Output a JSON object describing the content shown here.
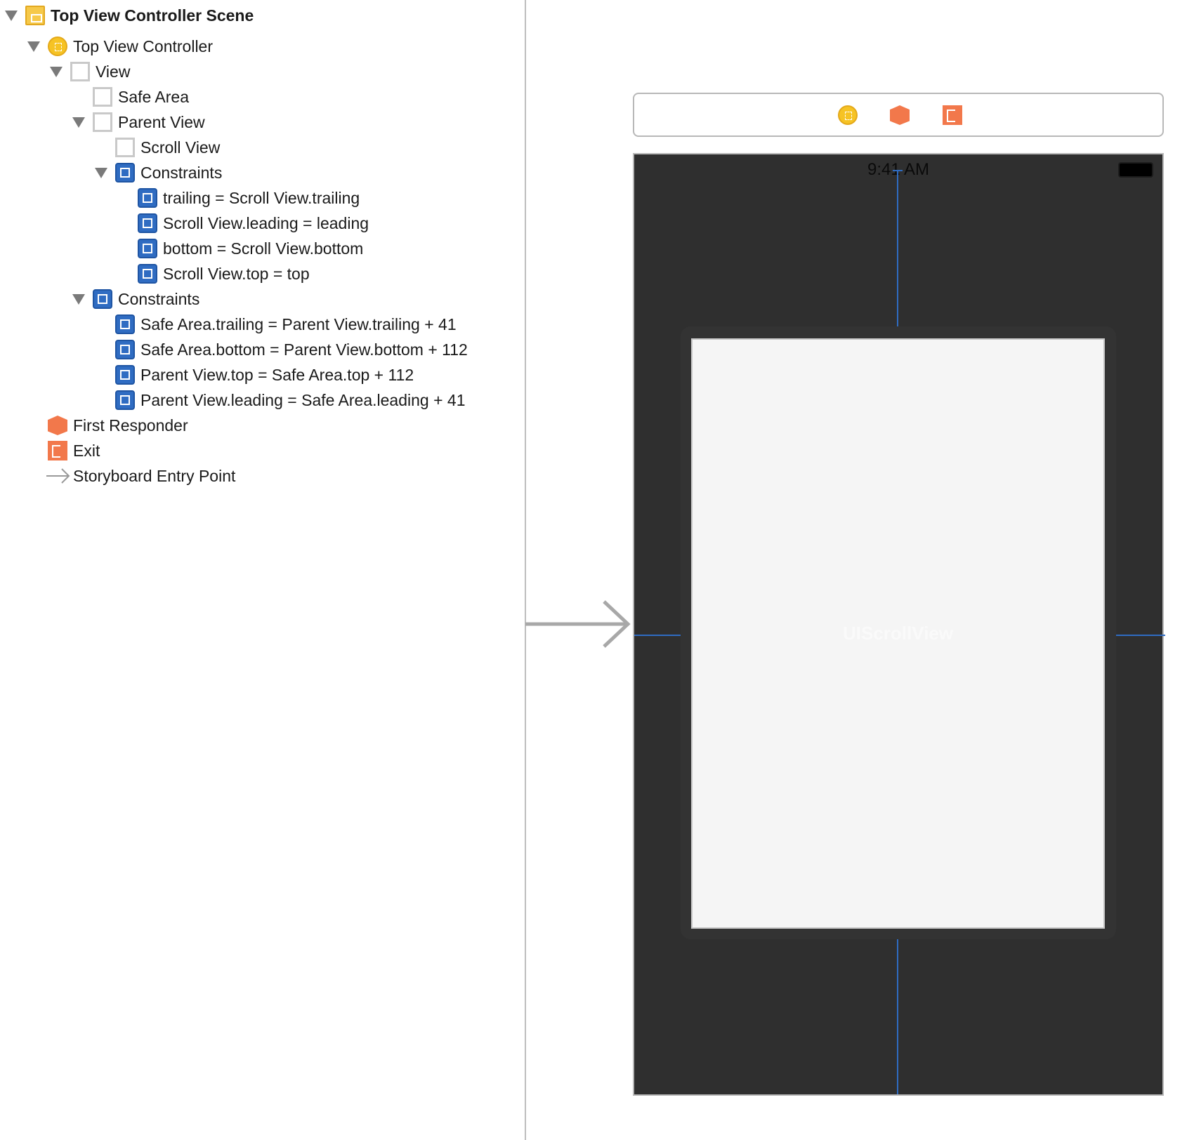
{
  "outline": {
    "rows": [
      {
        "label": "Top View Controller Scene",
        "icon": "scene-icon",
        "expanded": true
      },
      {
        "label": "Top View Controller",
        "icon": "view-controller-icon",
        "expanded": true
      },
      {
        "label": "View",
        "icon": "view-icon",
        "expanded": true
      },
      {
        "label": "Safe Area",
        "icon": "safe-area-icon"
      },
      {
        "label": "Parent View",
        "icon": "view-icon",
        "expanded": true
      },
      {
        "label": "Scroll View",
        "icon": "scroll-view-icon"
      },
      {
        "label": "Constraints",
        "icon": "constraints-icon",
        "expanded": true
      },
      {
        "label": "trailing = Scroll View.trailing",
        "icon": "constraint-trailing-icon"
      },
      {
        "label": "Scroll View.leading = leading",
        "icon": "constraint-leading-icon"
      },
      {
        "label": "bottom = Scroll View.bottom",
        "icon": "constraint-bottom-icon"
      },
      {
        "label": "Scroll View.top = top",
        "icon": "constraint-top-icon"
      },
      {
        "label": "Constraints",
        "icon": "constraints-icon",
        "expanded": true
      },
      {
        "label": "Safe Area.trailing = Parent View.trailing + 41",
        "icon": "constraint-trailing-icon"
      },
      {
        "label": "Safe Area.bottom = Parent View.bottom + 112",
        "icon": "constraint-bottom-icon"
      },
      {
        "label": "Parent View.top = Safe Area.top + 112",
        "icon": "constraint-top-icon"
      },
      {
        "label": "Parent View.leading = Safe Area.leading + 41",
        "icon": "constraint-leading-icon"
      },
      {
        "label": "First Responder",
        "icon": "first-responder-icon"
      },
      {
        "label": "Exit",
        "icon": "exit-icon"
      },
      {
        "label": "Storyboard Entry Point",
        "icon": "entry-arrow-icon"
      }
    ]
  },
  "canvas": {
    "status_time": "9:41 AM",
    "scroll_view_label": "UIScrollView",
    "dock_icons": [
      "view-controller-icon",
      "first-responder-icon",
      "exit-icon"
    ]
  },
  "colors": {
    "constraint": "#2f6cc2",
    "canvas_bg": "#2f2f2f",
    "accent_orange": "#f2784b",
    "accent_yellow": "#f6c324"
  }
}
